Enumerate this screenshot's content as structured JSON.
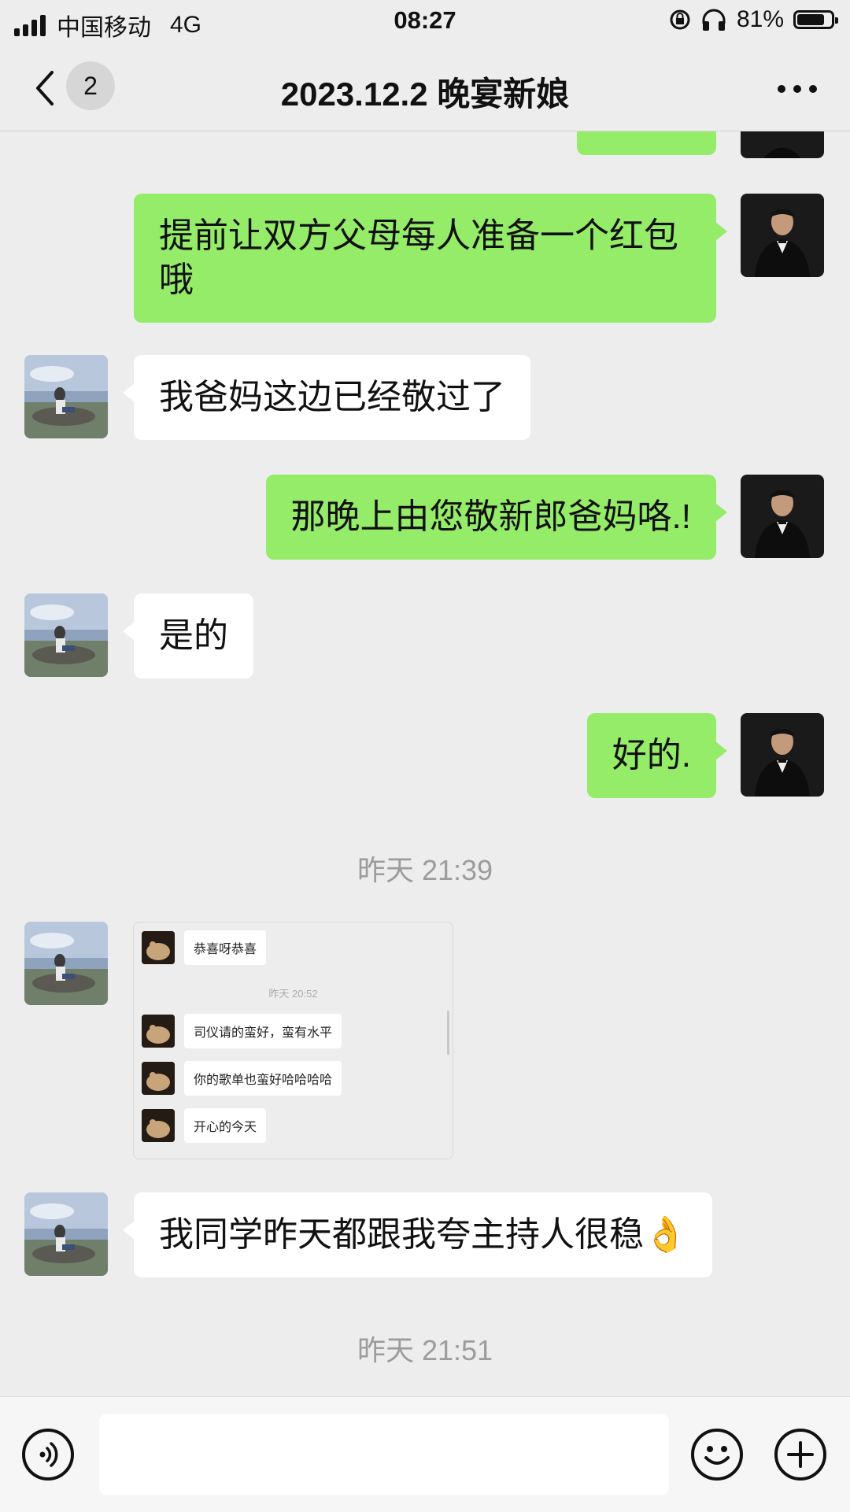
{
  "status_bar": {
    "carrier": "中国移动",
    "network": "4G",
    "time": "08:27",
    "battery": "81%",
    "battery_level": 0.81,
    "icons": [
      "signal-icon",
      "rotation-lock-icon",
      "headphones-icon",
      "battery-icon"
    ]
  },
  "nav": {
    "back_icon": "chevron-left-icon",
    "unread_count": "2",
    "title": "2023.12.2 晚宴新娘",
    "more_icon": "more-dots-icon"
  },
  "messages": [
    {
      "side": "mine",
      "text": "提前让双方父母每人准备一个红包哦"
    },
    {
      "side": "theirs",
      "text": "我爸妈这边已经敬过了"
    },
    {
      "side": "mine",
      "text": "那晚上由您敬新郎爸妈咯.!"
    },
    {
      "side": "theirs",
      "text": "是的"
    },
    {
      "side": "mine",
      "text": "好的."
    },
    {
      "type": "timestamp",
      "text": "昨天 21:39"
    },
    {
      "side": "theirs",
      "type": "image",
      "text": ""
    },
    {
      "side": "theirs",
      "text": "我同学昨天都跟我夸主持人很稳👌"
    },
    {
      "type": "timestamp",
      "text": "昨天 21:51"
    }
  ],
  "forwarded_screenshot": {
    "rows": [
      "恭喜呀恭喜",
      "司仪请的蛮好，蛮有水平",
      "你的歌单也蛮好哈哈哈哈",
      "开心的今天"
    ],
    "timestamp": "昨天 20:52"
  },
  "input_bar": {
    "voice_icon": "voice-icon",
    "input_value": "",
    "emoji_icon": "emoji-icon",
    "plus_icon": "plus-icon"
  },
  "colors": {
    "my_bubble": "#95ec69",
    "their_bubble": "#ffffff",
    "background": "#ededed"
  }
}
